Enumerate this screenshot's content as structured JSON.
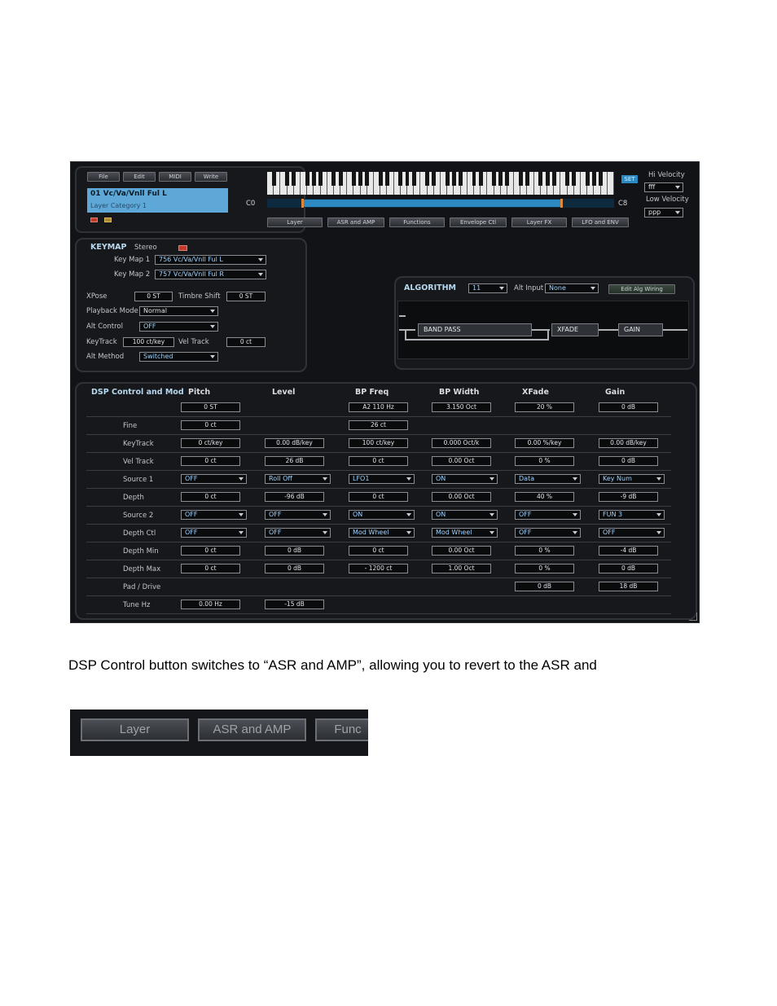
{
  "menu": {
    "file": "File",
    "edit": "Edit",
    "midi": "MIDI",
    "write": "Write"
  },
  "preset": {
    "name": "01  Vc/Va/Vnll Ful L",
    "category": "Layer Category 1"
  },
  "keyboard": {
    "low": "C0",
    "high": "C8",
    "set": "SET"
  },
  "velocity": {
    "hi_label": "Hi Velocity",
    "hi_value": "fff",
    "low_label": "Low Velocity",
    "low_value": "ppp"
  },
  "tabs": [
    "Layer",
    "ASR and AMP",
    "Functions",
    "Envelope Ctl",
    "Layer FX",
    "LFO and ENV"
  ],
  "keymap": {
    "title": "KEYMAP",
    "stereo": "Stereo",
    "km1_label": "Key Map 1",
    "km1_value": "756 Vc/Va/Vnll Ful L",
    "km2_label": "Key Map 2",
    "km2_value": "757 Vc/Va/Vnll Ful R",
    "xpose_label": "XPose",
    "xpose_value": "0 ST",
    "timbre_label": "Timbre Shift",
    "timbre_value": "0 ST",
    "playback_label": "Playback Mode",
    "playback_value": "Normal",
    "altctl_label": "Alt Control",
    "altctl_value": "OFF",
    "keytrack_label": "KeyTrack",
    "keytrack_value": "100 ct/key",
    "veltrack_label": "Vel Track",
    "veltrack_value": "0 ct",
    "altmethod_label": "Alt Method",
    "altmethod_value": "Switched"
  },
  "algorithm": {
    "title": "ALGORITHM",
    "value": "11",
    "altinput_label": "Alt Input",
    "altinput_value": "None",
    "edit_button": "Edit Alg Wiring",
    "blocks": {
      "bandpass": "BAND PASS",
      "xfade": "XFADE",
      "gain": "GAIN"
    }
  },
  "dsp": {
    "title": "DSP Control and Mod",
    "columns": [
      "Pitch",
      "Level",
      "BP Freq",
      "BP Width",
      "XFade",
      "Gain"
    ],
    "top": [
      "0 ST",
      "",
      "A2 110 Hz",
      "3.150 Oct",
      "20 %",
      "0 dB"
    ],
    "rows": [
      {
        "label": "Fine",
        "cells": [
          {
            "t": "f",
            "v": "0 ct"
          },
          null,
          {
            "t": "f",
            "v": "26 ct"
          },
          null,
          null,
          null
        ]
      },
      {
        "label": "KeyTrack",
        "cells": [
          {
            "t": "f",
            "v": "0 ct/key"
          },
          {
            "t": "f",
            "v": "0.00 dB/key"
          },
          {
            "t": "f",
            "v": "100 ct/key"
          },
          {
            "t": "f",
            "v": "0.000 Oct/k"
          },
          {
            "t": "f",
            "v": "0.00 %/key"
          },
          {
            "t": "f",
            "v": "0.00 dB/key"
          }
        ]
      },
      {
        "label": "Vel Track",
        "cells": [
          {
            "t": "f",
            "v": "0 ct"
          },
          {
            "t": "f",
            "v": "26 dB"
          },
          {
            "t": "f",
            "v": "0 ct"
          },
          {
            "t": "f",
            "v": "0.00 Oct"
          },
          {
            "t": "f",
            "v": "0 %"
          },
          {
            "t": "f",
            "v": "0 dB"
          }
        ]
      },
      {
        "label": "Source 1",
        "cells": [
          {
            "t": "d",
            "v": "OFF"
          },
          {
            "t": "d",
            "v": "Roll Off"
          },
          {
            "t": "d",
            "v": "LFO1"
          },
          {
            "t": "d",
            "v": "ON"
          },
          {
            "t": "d",
            "v": "Data"
          },
          {
            "t": "d",
            "v": "Key Num"
          }
        ]
      },
      {
        "label": "Depth",
        "cells": [
          {
            "t": "f",
            "v": "0 ct"
          },
          {
            "t": "f",
            "v": "-96 dB"
          },
          {
            "t": "f",
            "v": "0 ct"
          },
          {
            "t": "f",
            "v": "0.00 Oct"
          },
          {
            "t": "f",
            "v": "40 %"
          },
          {
            "t": "f",
            "v": "-9 dB"
          }
        ]
      },
      {
        "label": "Source 2",
        "cells": [
          {
            "t": "d",
            "v": "OFF"
          },
          {
            "t": "d",
            "v": "OFF"
          },
          {
            "t": "d",
            "v": "ON"
          },
          {
            "t": "d",
            "v": "ON"
          },
          {
            "t": "d",
            "v": "OFF"
          },
          {
            "t": "d",
            "v": "FUN 3"
          }
        ]
      },
      {
        "label": "Depth Ctl",
        "cells": [
          {
            "t": "d",
            "v": "OFF"
          },
          {
            "t": "d",
            "v": "OFF"
          },
          {
            "t": "d",
            "v": "Mod Wheel"
          },
          {
            "t": "d",
            "v": "Mod Wheel"
          },
          {
            "t": "d",
            "v": "OFF"
          },
          {
            "t": "d",
            "v": "OFF"
          }
        ]
      },
      {
        "label": "Depth Min",
        "cells": [
          {
            "t": "f",
            "v": "0 ct"
          },
          {
            "t": "f",
            "v": "0 dB"
          },
          {
            "t": "f",
            "v": "0 ct"
          },
          {
            "t": "f",
            "v": "0.00 Oct"
          },
          {
            "t": "f",
            "v": "0 %"
          },
          {
            "t": "f",
            "v": "-4 dB"
          }
        ]
      },
      {
        "label": "Depth Max",
        "cells": [
          {
            "t": "f",
            "v": "0 ct"
          },
          {
            "t": "f",
            "v": "0 dB"
          },
          {
            "t": "f",
            "v": "- 1200 ct"
          },
          {
            "t": "f",
            "v": "1.00 Oct"
          },
          {
            "t": "f",
            "v": "0 %"
          },
          {
            "t": "f",
            "v": "0 dB"
          }
        ]
      },
      {
        "label": "Pad / Drive",
        "cells": [
          null,
          null,
          null,
          null,
          {
            "t": "f",
            "v": "0 dB"
          },
          {
            "t": "f",
            "v": "18 dB"
          }
        ]
      },
      {
        "label": "Tune Hz",
        "cells": [
          {
            "t": "f",
            "v": "0.00 Hz"
          },
          {
            "t": "f",
            "v": "-15 dB"
          },
          null,
          null,
          null,
          null
        ]
      }
    ]
  },
  "caption": "DSP Control button switches to “ASR and AMP”, allowing you to revert to the ASR and",
  "zoom_tabs": [
    "Layer",
    "ASR and AMP",
    "Func"
  ]
}
